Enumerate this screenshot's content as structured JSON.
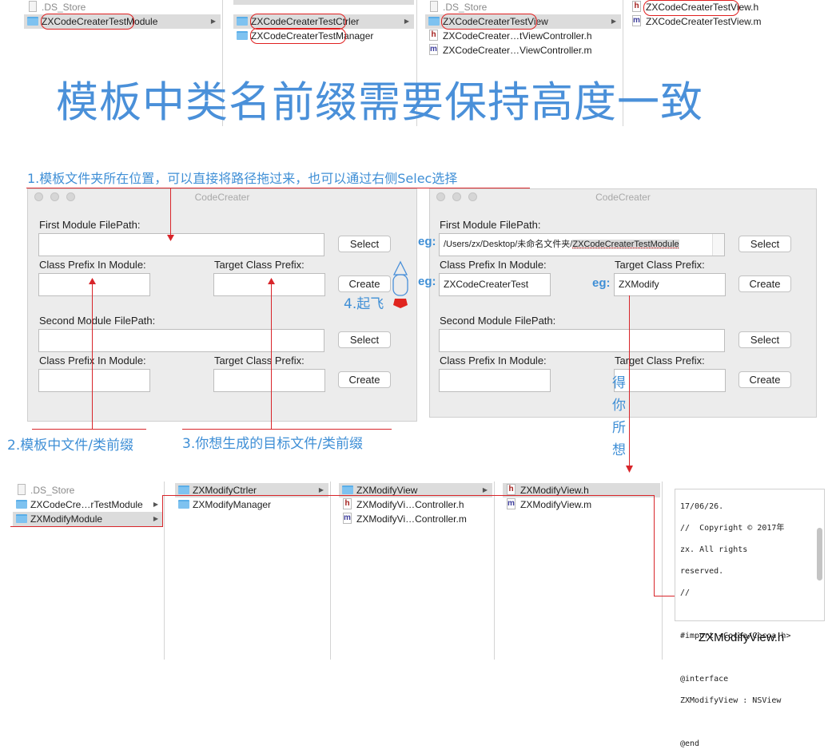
{
  "top_finder": {
    "col1": [
      ".DS_Store",
      "ZXCodeCreaterTestModule"
    ],
    "col2": [
      "ZXCodeCreaterTestCtrler",
      "ZXCodeCreaterTestManager"
    ],
    "col3": [
      ".DS_Store",
      "ZXCodeCreaterTestView",
      "ZXCodeCreater…tViewController.h",
      "ZXCodeCreater…ViewController.m"
    ],
    "col4": [
      "ZXCodeCreaterTestView.h",
      "ZXCodeCreaterTestView.m"
    ]
  },
  "headline": "模板中类名前缀需要保持高度一致",
  "notes": {
    "step1": "1.模板文件夹所在位置，可以直接将路径拖过来，也可以通过右侧Selec选择",
    "step2": "2.模板中文件/类前缀",
    "step3": "3.你想生成的目标文件/类前缀",
    "step4": "4.起飞",
    "get_what_you_want": [
      "得",
      "你",
      "所",
      "想"
    ]
  },
  "windows": {
    "title": "CodeCreater",
    "first_module_label": "First Module FilePath:",
    "class_prefix_label": "Class Prefix In Module:",
    "target_prefix_label": "Target Class Prefix:",
    "second_module_label": "Second Module FilePath:",
    "select_label": "Select",
    "create_label": "Create",
    "eg": "eg:",
    "left_values": {
      "first_path": "",
      "class_prefix1": "",
      "target_prefix1": "",
      "second_path": "",
      "class_prefix2": "",
      "target_prefix2": ""
    },
    "right_values": {
      "first_path_prefix": "/Users/zx/Desktop/未命名文件夹/",
      "first_path_sel": "ZXCodeCreaterTestModule",
      "class_prefix1": "ZXCodeCreaterTest",
      "target_prefix1": "ZXModify",
      "second_path": "",
      "class_prefix2": "",
      "target_prefix2": ""
    }
  },
  "bottom_finder": {
    "col1": [
      ".DS_Store",
      "ZXCodeCre…rTestModule",
      "ZXModifyModule"
    ],
    "col2": [
      "ZXModifyCtrler",
      "ZXModifyManager"
    ],
    "col3": [
      "ZXModifyView",
      "ZXModifyVi…Controller.h",
      "ZXModifyVi…Controller.m"
    ],
    "col4": [
      "ZXModifyView.h",
      "ZXModifyView.m"
    ]
  },
  "code_preview": {
    "lines": [
      "17/06/26.",
      "//  Copyright © 2017年",
      "zx. All rights",
      "reserved.",
      "//",
      "",
      "#import <Cocoa/Cocoa.h>",
      "",
      "@interface",
      "ZXModifyView : NSView",
      "",
      "@end"
    ],
    "caption": "ZXModifyView.h"
  }
}
